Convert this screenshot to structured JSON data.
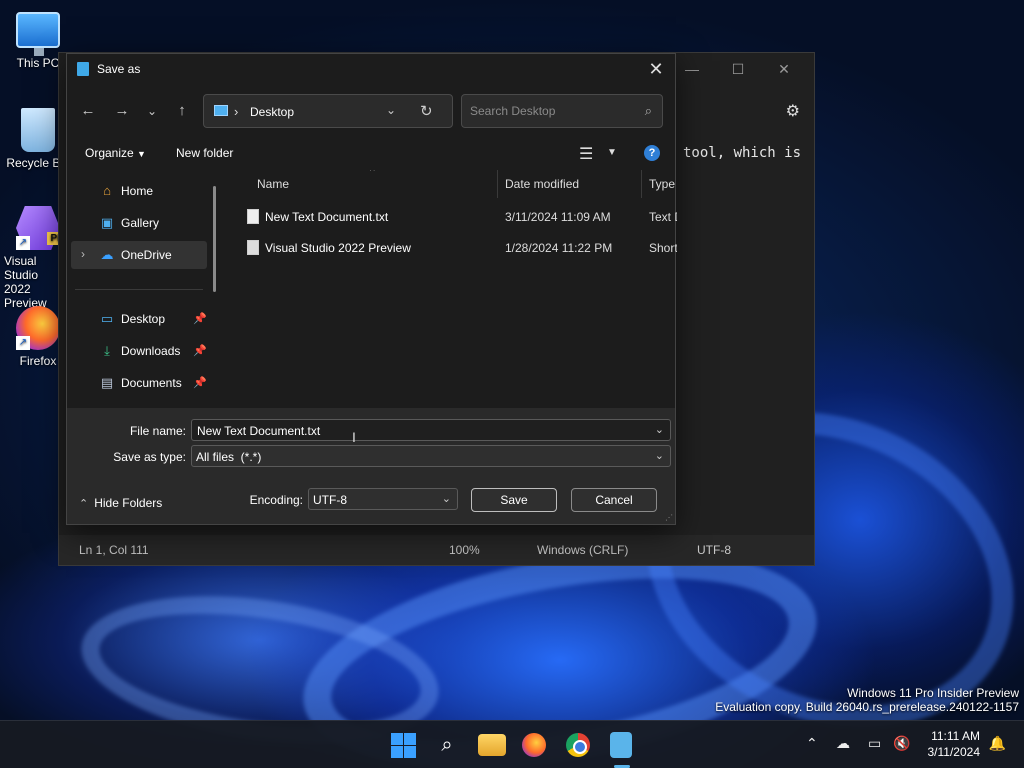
{
  "desktop": {
    "icons": [
      {
        "label": "This PC"
      },
      {
        "label": "Recycle Bin"
      },
      {
        "label": "Visual Studio 2022 Preview",
        "badge": "PRE"
      },
      {
        "label": "Firefox"
      }
    ],
    "watermark_line1": "Windows 11 Pro Insider Preview",
    "watermark_line2": "Evaluation copy. Build 26040.rs_prerelease.240122-1157"
  },
  "notepad": {
    "text_fragment": "tool, which is",
    "status": {
      "position": "Ln 1, Col 111",
      "zoom": "100%",
      "line_ending": "Windows (CRLF)",
      "encoding": "UTF-8"
    }
  },
  "dialog": {
    "title": "Save as",
    "address": {
      "current": "Desktop"
    },
    "search": {
      "placeholder": "Search Desktop"
    },
    "commands": {
      "organize": "Organize",
      "new_folder": "New folder"
    },
    "nav": {
      "items": [
        {
          "label": "Home",
          "icon": "home-icon"
        },
        {
          "label": "Gallery",
          "icon": "gallery-icon"
        },
        {
          "label": "OneDrive",
          "icon": "cloud-icon"
        },
        {
          "label": "Desktop",
          "icon": "desktop-icon"
        },
        {
          "label": "Downloads",
          "icon": "download-icon"
        },
        {
          "label": "Documents",
          "icon": "documents-icon"
        }
      ]
    },
    "columns": {
      "name": "Name",
      "date": "Date modified",
      "type": "Type"
    },
    "files": [
      {
        "name": "New Text Document.txt",
        "date": "3/11/2024 11:09 AM",
        "type": "Text D"
      },
      {
        "name": "Visual Studio 2022 Preview",
        "date": "1/28/2024 11:22 PM",
        "type": "Short"
      }
    ],
    "form": {
      "file_name_label": "File name:",
      "file_name_value": "New Text Document.txt",
      "type_label": "Save as type:",
      "type_value": "All files  (*.*)",
      "encoding_label": "Encoding:",
      "encoding_value": "UTF-8",
      "save": "Save",
      "cancel": "Cancel",
      "hide_folders": "Hide Folders"
    }
  },
  "taskbar": {
    "time": "11:11 AM",
    "date": "3/11/2024"
  },
  "colors": {
    "accent": "#3aa0ff",
    "dialog_bg": "#1c1c1c"
  }
}
